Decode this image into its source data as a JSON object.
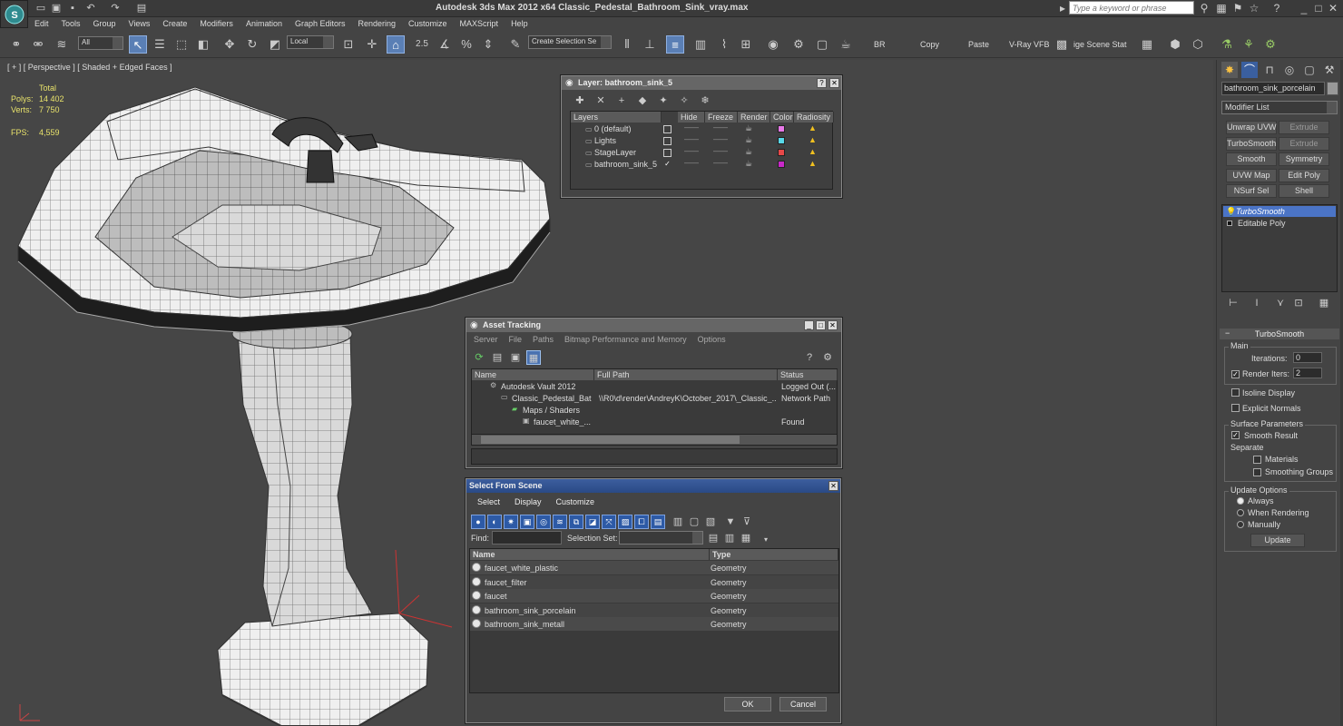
{
  "app": {
    "title": "Autodesk 3ds Max  2012 x64    Classic_Pedestal_Bathroom_Sink_vray.max",
    "search_placeholder": "Type a keyword or phrase"
  },
  "menu": [
    "Edit",
    "Tools",
    "Group",
    "Views",
    "Create",
    "Modifiers",
    "Animation",
    "Graph Editors",
    "Rendering",
    "Customize",
    "MAXScript",
    "Help"
  ],
  "toolbar": {
    "filter": "All",
    "coord": "Local",
    "snap_angle": "2.5",
    "selection_set": "Create Selection Se",
    "br": "BR",
    "copy": "Copy",
    "paste": "Paste",
    "vray_vfb": "V-Ray VFB",
    "image_scene": "ige Scene Stat"
  },
  "viewport": {
    "label": "[ + ] [ Perspective ] [ Shaded + Edged Faces ]",
    "stats": {
      "total_label": "Total",
      "polys_label": "Polys:",
      "polys": "14 402",
      "verts_label": "Verts:",
      "verts": "7 750",
      "fps_label": "FPS:",
      "fps": "4,559"
    }
  },
  "layer_dialog": {
    "title": "Layer: bathroom_sink_5",
    "columns": [
      "Layers",
      "Hide",
      "Freeze",
      "Render",
      "Color",
      "Radiosity"
    ],
    "rows": [
      {
        "name": "0 (default)",
        "color": "#e878e8",
        "checked": false
      },
      {
        "name": "Lights",
        "color": "#58d8e8",
        "checked": false
      },
      {
        "name": "StageLayer",
        "color": "#e84848",
        "checked": false
      },
      {
        "name": "bathroom_sink_5",
        "color": "#c828c8",
        "checked": true
      }
    ]
  },
  "asset_dialog": {
    "title": "Asset Tracking",
    "menu": [
      "Server",
      "File",
      "Paths",
      "Bitmap Performance and Memory",
      "Options"
    ],
    "columns": [
      "Name",
      "Full Path",
      "Status"
    ],
    "rows": [
      {
        "name": "Autodesk Vault 2012",
        "path": "",
        "status": "Logged Out (..."
      },
      {
        "name": "Classic_Pedestal_Bat...",
        "path": "\\\\R0\\d\\render\\AndreyK\\October_2017\\_Classic_...",
        "status": "Network Path"
      },
      {
        "name": "Maps / Shaders",
        "path": "",
        "status": ""
      },
      {
        "name": "faucet_white_...",
        "path": "",
        "status": "Found"
      }
    ]
  },
  "select_dialog": {
    "title": "Select From Scene",
    "menu": [
      "Select",
      "Display",
      "Customize"
    ],
    "find_label": "Find:",
    "selset_label": "Selection Set:",
    "columns": [
      "Name",
      "Type"
    ],
    "rows": [
      {
        "name": "faucet_white_plastic",
        "type": "Geometry"
      },
      {
        "name": "faucet_filter",
        "type": "Geometry"
      },
      {
        "name": "faucet",
        "type": "Geometry"
      },
      {
        "name": "bathroom_sink_porcelain",
        "type": "Geometry"
      },
      {
        "name": "bathroom_sink_metall",
        "type": "Geometry"
      }
    ],
    "ok": "OK",
    "cancel": "Cancel"
  },
  "command_panel": {
    "object_name": "bathroom_sink_porcelain",
    "modifier_list": "Modifier List",
    "buttons": [
      {
        "label": "Unwrap UVW",
        "dim": false
      },
      {
        "label": "Extrude",
        "dim": true
      },
      {
        "label": "TurboSmooth",
        "dim": false
      },
      {
        "label": "Extrude",
        "dim": true
      },
      {
        "label": "Smooth",
        "dim": false
      },
      {
        "label": "Symmetry",
        "dim": false
      },
      {
        "label": "UVW Map",
        "dim": false
      },
      {
        "label": "Edit Poly",
        "dim": false
      },
      {
        "label": "NSurf Sel",
        "dim": false
      },
      {
        "label": "Shell",
        "dim": false
      }
    ],
    "stack": [
      "TurboSmooth",
      "Editable Poly"
    ],
    "rollout_title": "TurboSmooth",
    "main_label": "Main",
    "iterations_label": "Iterations:",
    "iterations": "0",
    "render_iters_label": "Render Iters:",
    "render_iters": "2",
    "isoline": "Isoline Display",
    "explicit": "Explicit Normals",
    "surface_label": "Surface Parameters",
    "smooth_result": "Smooth Result",
    "separate": "Separate",
    "materials": "Materials",
    "smoothing_groups": "Smoothing Groups",
    "update_options": "Update Options",
    "always": "Always",
    "when_rendering": "When Rendering",
    "manually": "Manually",
    "update": "Update"
  }
}
